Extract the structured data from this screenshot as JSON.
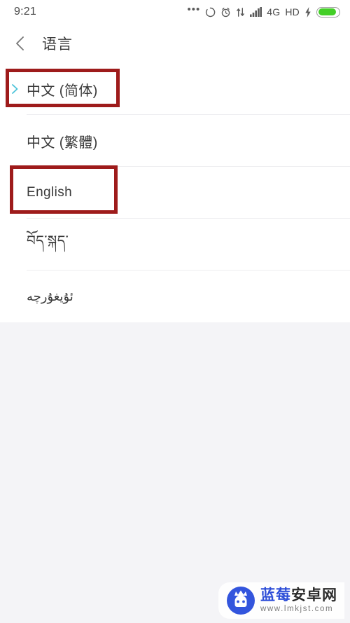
{
  "status_bar": {
    "clock": "9:21",
    "icons": [
      {
        "name": "more-dots-icon",
        "glyph": "•••"
      },
      {
        "name": "sync-circle-icon",
        "glyph": ""
      },
      {
        "name": "alarm-clock-icon",
        "glyph": ""
      },
      {
        "name": "data-transfer-icon",
        "glyph": ""
      },
      {
        "name": "signal-bars-icon",
        "glyph": ""
      }
    ],
    "network_label": "4G",
    "hd_label": "HD",
    "charging_icon": "lightning-bolt-icon",
    "battery": {
      "name": "battery-icon",
      "fill_percent": 88,
      "color": "#43cf27"
    }
  },
  "app_bar": {
    "back_icon": "back-chevron-icon",
    "title": "语言"
  },
  "language_list": [
    {
      "label": "中文 (简体)",
      "selected": true,
      "script": "cjk"
    },
    {
      "label": "中文 (繁體)",
      "selected": false,
      "script": "cjk"
    },
    {
      "label": "English",
      "selected": false,
      "script": "latin"
    },
    {
      "label": "བོད་སྐད་",
      "selected": false,
      "script": "tibetan"
    },
    {
      "label": "ئۇيغۇرچە",
      "selected": false,
      "script": "uyghur"
    }
  ],
  "annotations": [
    {
      "name": "highlight-box-chinese-simplified",
      "target": "中文 (简体)",
      "color": "#9e1b1b"
    },
    {
      "name": "highlight-box-english",
      "target": "English",
      "color": "#9e1b1b"
    }
  ],
  "colors": {
    "selected_chevron": "#4cc3d9",
    "annotation_red": "#9e1b1b",
    "page_background": "#f4f4f7",
    "list_background": "#ffffff",
    "divider": "#ededf0"
  },
  "watermark": {
    "site_name_part1": "蓝莓",
    "site_name_part2": "安卓网",
    "url": "www.lmkjst.com",
    "logo": "blueberry-android-logo"
  }
}
